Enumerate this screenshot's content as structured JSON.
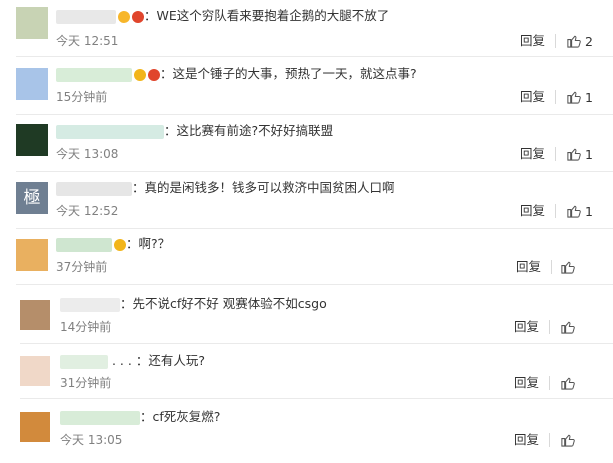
{
  "comments": [
    {
      "comment": "：WE这个穷队看来要抱着企鹅的大腿不放了",
      "time": "今天 12:51",
      "reply": "回复",
      "likes": "2",
      "name_color": "#e8e8e8",
      "avatar_color": "#c8d3b4",
      "badges": [
        "#f7b62a",
        "#e0452c"
      ]
    },
    {
      "comment": "：这是个锤子的大事，预热了一天，就这点事?",
      "time": "15分钟前",
      "reply": "回复",
      "likes": "1",
      "name_color": "#d8edd8",
      "avatar_color": "#a8c4e8",
      "badges": [
        "#f2b51a",
        "#e0452c"
      ]
    },
    {
      "comment": "：这比赛有前途?不好好搞联盟",
      "time": "今天 13:08",
      "reply": "回复",
      "likes": "1",
      "name_color": "#d5ebe3",
      "avatar_color": "#1f3a24",
      "badges": []
    },
    {
      "comment": "：真的是闲钱多！钱多可以救济中国贫困人口啊",
      "time": "今天 12:52",
      "reply": "回复",
      "likes": "1",
      "name_color": "#e6e6e6",
      "avatar_color": "#6f7f92",
      "avatar_glyph": "極",
      "badges": []
    },
    {
      "comment": "：啊?？",
      "time": "37分钟前",
      "reply": "回复",
      "likes": "",
      "name_color": "#cfe6d0",
      "avatar_color": "#e9b060",
      "badges": [
        "#f2b51a"
      ]
    },
    {
      "comment": "：先不说cf好不好 观赛体验不如csgo",
      "time": "14分钟前",
      "reply": "回复",
      "likes": "",
      "name_color": "#ececec",
      "avatar_color": "#b58e6a",
      "badges": []
    },
    {
      "comment": "：还有人玩?",
      "time": "31分钟前",
      "reply": "回复",
      "likes": "",
      "name_color": "#e1efe1",
      "avatar_color": "#f0d8c8",
      "badges": []
    },
    {
      "comment": "：cf死灰复燃?",
      "time": "今天 13:05",
      "reply": "回复",
      "likes": "",
      "name_color": "#d8ecd8",
      "avatar_color": "#d28a3c",
      "badges": []
    }
  ]
}
